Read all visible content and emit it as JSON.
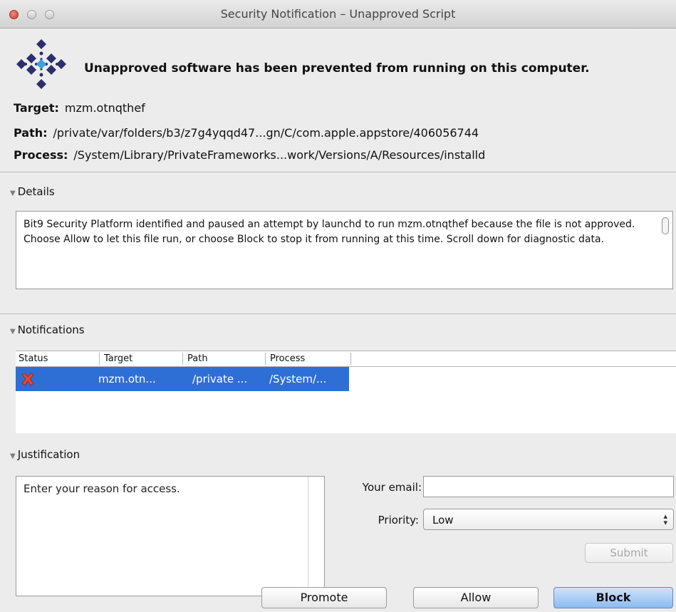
{
  "window": {
    "title": "Security Notification – Unapproved Script"
  },
  "header": {
    "headline": "Unapproved software has been prevented from running on this computer."
  },
  "info": {
    "target_label": "Target:",
    "target_value": "mzm.otnqthef",
    "path_label": "Path:",
    "path_value": "/private/var/folders/b3/z7g4yqqd47...gn/C/com.apple.appstore/406056744",
    "process_label": "Process:",
    "process_value": "/System/Library/PrivateFrameworks...work/Versions/A/Resources/installd"
  },
  "details": {
    "heading": "Details",
    "text": "Bit9 Security Platform identified and paused an attempt by launchd to run mzm.otnqthef because the file is not approved.  Choose Allow to let this file run, or choose Block to stop it from running at this time. Scroll down for diagnostic data."
  },
  "notifications": {
    "heading": "Notifications",
    "columns": [
      "Status",
      "Target",
      "Path",
      "Process"
    ],
    "rows": [
      {
        "status_icon": "red-x-icon",
        "target": "mzm.otn...",
        "path": "/private ...",
        "process": "/System/..."
      }
    ]
  },
  "justification": {
    "heading": "Justification",
    "placeholder": "Enter your reason for access.",
    "email_label": "Your email:",
    "email_value": "",
    "priority_label": "Priority:",
    "priority_value": "Low",
    "submit_label": "Submit"
  },
  "actions": {
    "promote": "Promote",
    "allow": "Allow",
    "block": "Block"
  },
  "colors": {
    "selection": "#2e6fd6",
    "default_button": "#8bbaf0",
    "close_button": "#cf3b30"
  }
}
